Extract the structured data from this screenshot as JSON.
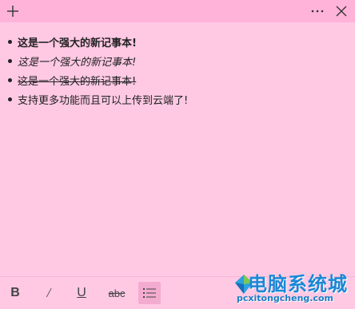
{
  "titlebar": {
    "add_icon": "plus-icon",
    "more_icon": "more-icon",
    "close_icon": "close-icon",
    "background": "#ffb3d8"
  },
  "note": {
    "background": "#ffc9e4",
    "lines": [
      {
        "text": "这是一个强大的新记事本!",
        "style": "bold"
      },
      {
        "text": "这是一个强大的新记事本!",
        "style": "italic"
      },
      {
        "text": "这是一个强大的新记事本!",
        "style": "strikethrough"
      },
      {
        "text": "支持更多功能而且可以上传到云端了!",
        "style": "normal"
      }
    ]
  },
  "toolbar": {
    "bold_label": "B",
    "italic_label": "/",
    "underline_label": "U",
    "strike_label": "abc",
    "list_icon": "bullet-list-icon",
    "list_active": true
  },
  "watermark": {
    "title": "电脑系统城",
    "url": "pcxitongcheng.com"
  }
}
